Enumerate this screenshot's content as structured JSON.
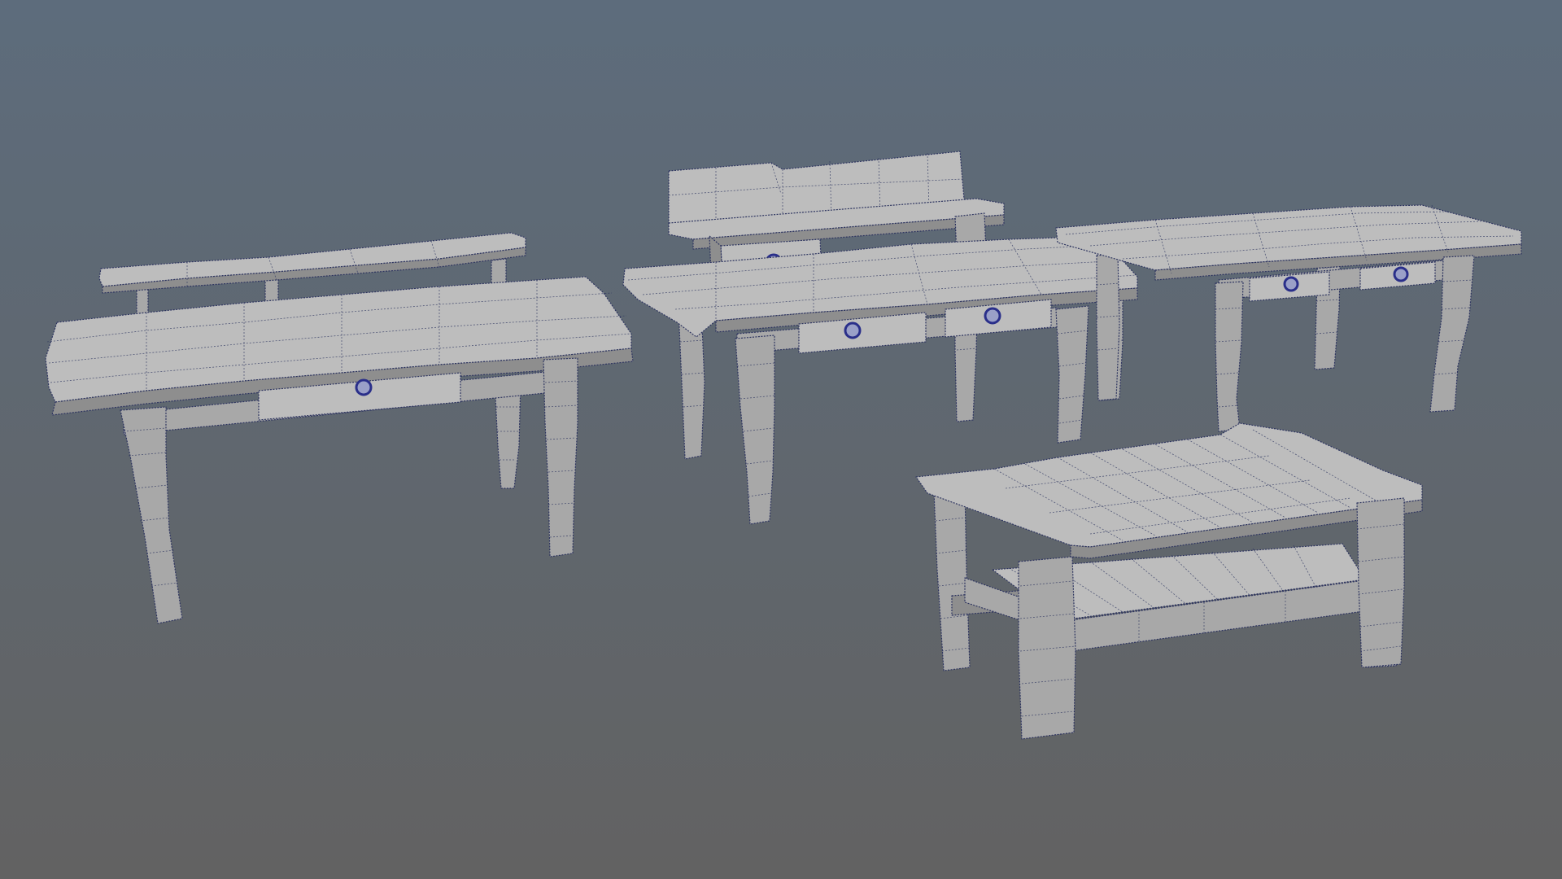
{
  "viewport": {
    "background_top": "#5d6c7c",
    "background_bottom": "#626262",
    "mesh_fill": "#a8a8a8",
    "mesh_light": "#bdbdbd",
    "mesh_dark": "#8e8e8e",
    "wire_color": "#2e3560",
    "knob_color": "#2a2f8a"
  }
}
